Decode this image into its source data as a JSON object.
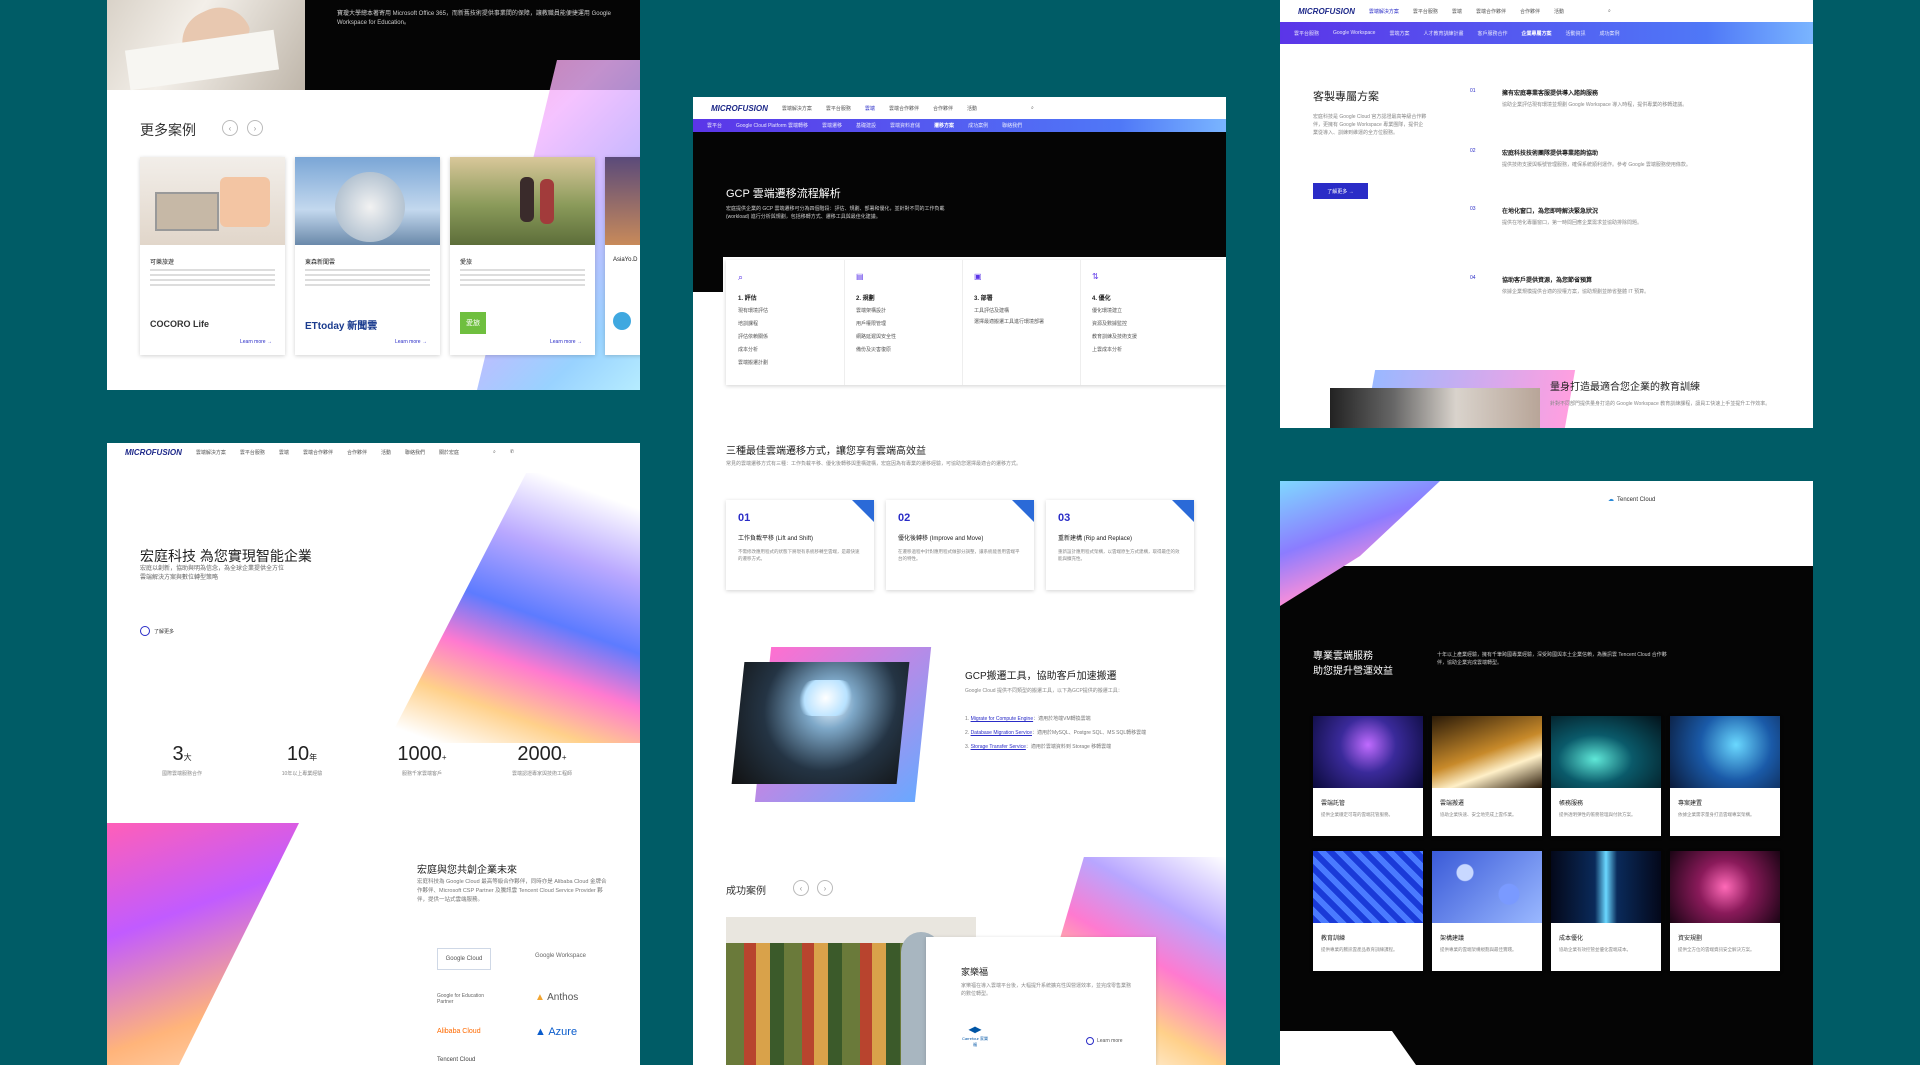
{
  "p1": {
    "top_text": "寶瓊大學總本著寄用 Microsoft Office 365，而新舊技術提供事業間的保障，讓教職員能便捷運用 Google Workspace for Education。",
    "more_cases_title": "更多案例",
    "cases": [
      {
        "title": "可樂旅遊",
        "logo": "COCORO Life",
        "link": "Learn more →"
      },
      {
        "title": "東森新聞雲",
        "logo": "ETtoday 新聞雲",
        "link": "Learn more →"
      },
      {
        "title": "愛旅",
        "logo": "愛旅",
        "link": "Learn more →"
      },
      {
        "title": "AsiaYo.D",
        "logo": "",
        "link": ""
      }
    ]
  },
  "p2": {
    "nav_items": [
      "雲端解決方案",
      "雲平台服務",
      "雲端",
      "雲端合作夥伴",
      "合作夥伴",
      "活動",
      "聯絡我們",
      "關於宏庭"
    ],
    "hero_title": "宏庭科技 為您實現智能企業",
    "hero_sub": "宏庭以創新，協助與明為信念，為全球企業提供全方位雲端解決方案與數位轉型策略",
    "hero_link": "了解更多",
    "stats": [
      {
        "num": "3",
        "unit": "大",
        "label": "國際雲端服務合作"
      },
      {
        "num": "10",
        "unit": "年",
        "label": "10年以上專業經驗"
      },
      {
        "num": "1000",
        "unit": "+",
        "label": "服務千家雲端客戶"
      },
      {
        "num": "2000",
        "unit": "+",
        "label": "雲端認證專家與技術工程師"
      }
    ],
    "future_title": "宏庭與您共創企業未來",
    "future_text": "宏庭科技為 Google Cloud 最高等級合作夥伴，同時亦是 Alibaba Cloud 金牌合作夥伴、Microsoft CSP Partner 及騰訊雲 Tencent Cloud Service Provider 夥伴，提供一站式雲端服務。",
    "partners": [
      "Google Cloud",
      "Google Workspace",
      "Google for Education Partner",
      "Anthos",
      "Alibaba Cloud",
      "Azure",
      "Tencent Cloud"
    ]
  },
  "p3": {
    "brand": "MICROFUSION",
    "subnav": [
      "雲平台",
      "Google Cloud Platform 雲端轉移",
      "雲端遷移",
      "基礎建設",
      "雲端資料倉儲",
      "遷移方案",
      "成功案例",
      "聯絡我們"
    ],
    "hero_title": "GCP 雲端遷移流程解析",
    "hero_text": "宏庭提供企業的 GCP 雲端遷移可分為四個階段：評估、規劃、部署和優化，並針對不同的工作負載 (workload) 進行分析與規劃，包括移轉方式、遷移工具與最佳化建議。",
    "steps": [
      {
        "title": "1. 評估",
        "items": [
          "現有環境評估",
          "培訓課程",
          "評估依賴關係",
          "成本分析",
          "雲端搬遷計劃"
        ]
      },
      {
        "title": "2. 規劃",
        "items": [
          "雲端架構設計",
          "用戶權限管理",
          "網路延遲與安全性",
          "備份及災害復原"
        ]
      },
      {
        "title": "3. 部署",
        "items": [
          "工具評估及建構",
          "選擇最適搬遷工具進行環境部署"
        ]
      },
      {
        "title": "4. 優化",
        "items": [
          "優化環境建立",
          "資源及數據監控",
          "教育訓練及技術支援",
          "上雲成本分析"
        ]
      }
    ],
    "methods_title": "三種最佳雲端遷移方式，讓您享有雲端高效益",
    "methods_sub": "常見的雲端遷移方式有三種：工作負載平移、優化後轉移與重構建構，宏庭因為有專業的遷移經驗，可協助您選擇最適合的遷移方式。",
    "methods": [
      {
        "num": "01",
        "title": "工作負載平移 (Lift and Shift)",
        "text": "不需修改應用程式的狀態下將現有系統移轉至雲端，是最快速的遷移方式。"
      },
      {
        "num": "02",
        "title": "優化後轉移 (Improve and Move)",
        "text": "在遷移過程中針對應用程式做部分調整，讓系統能善用雲端平台的特性。"
      },
      {
        "num": "03",
        "title": "重新建構 (Rip and Replace)",
        "text": "重新設計應用程式架構，以雲端原生方式建構，取得最佳的效能與擴充性。"
      }
    ],
    "tools_title": "GCP搬遷工具，協助客戶加速搬遷",
    "tools_text": "Google Cloud 提供不同類型的搬遷工具，以下為GCP提供的搬遷工具：",
    "tools": [
      {
        "link": "Migrate for Compute Engine",
        "desc": "：適用於地端VM轉換雲端"
      },
      {
        "link": "Database Migration Service",
        "desc": "：適用於MySQL、Postgre SQL、MS SQL轉移雲端"
      },
      {
        "link": "Storage Transfer Service",
        "desc": "：適用於雲端資料到 Storage 移轉雲端"
      }
    ],
    "success_title": "成功案例",
    "case_title": "家樂福",
    "case_text": "家樂福在導入雲端平台後，大幅提升系統擴充性與營運效率，並完成零售業務的數位轉型。",
    "case_logo": "Carrefour 家樂福",
    "case_link": "Learn more"
  },
  "p4": {
    "brand": "MICROFUSION",
    "subnav": [
      "雲平台服務",
      "Google Workspace",
      "雲端方案",
      "人才教育訓練計畫",
      "客戶服務合作",
      "企業專屬方案",
      "活動資訊",
      "成功案例",
      "聯絡我們"
    ],
    "title": "客製專屬方案",
    "intro": "宏庭科技是 Google Cloud 官方認證最高等級合作夥伴，更擁有 Google Workspace 專業團隊，提供企業從導入、訓練到維運的全方位服務。",
    "button": "了解更多 →",
    "items": [
      {
        "num": "01",
        "title": "擁有宏庭專業客服提供導入諮詢服務",
        "text": "協助企業評估現有環境並規劃 Google Workspace 導入時程，提供專業的移轉建議。"
      },
      {
        "num": "02",
        "title": "宏庭科技技術團隊提供專業諮詢協助",
        "text": "提供技術支援與帳號管理服務，確保系統順利運作。參考 Google 雲端服務使用條款。"
      },
      {
        "num": "03",
        "title": "在地化窗口，為您即時解決緊急狀況",
        "text": "提供在地化專屬窗口，第一時間回應企業需求並協助排除問題。"
      },
      {
        "num": "04",
        "title": "協助客戶提供資源，為您節省預算",
        "text": "依據企業規模提供合適的授權方案，協助規劃並節省整體 IT 預算。"
      }
    ],
    "training_title": "量身打造最適合您企業的教育訓練",
    "training_text": "針對不同部門提供量身打造的 Google Workspace 教育訓練課程，讓員工快速上手並提升工作效率。"
  },
  "p5": {
    "partner_logo": "Tencent Cloud",
    "title_line1": "專業雲端服務",
    "title_line2": "助您提升營運效益",
    "intro": "十年以上產業經驗，擁有千筆跨國專業經驗，深受跨國與本土企業信賴，為騰訊雲 Tencent Cloud 合作夥伴，協助企業完成雲端轉型。",
    "services": [
      {
        "title": "雲端託管",
        "text": "提供企業穩定可靠的雲端託管服務。"
      },
      {
        "title": "雲端搬遷",
        "text": "協助企業快速、安全地完成上雲作業。"
      },
      {
        "title": "帳務服務",
        "text": "提供透明彈性的帳務管理與付款方案。"
      },
      {
        "title": "專案建置",
        "text": "依據企業需求量身打造雲端專案架構。"
      },
      {
        "title": "教育訓練",
        "text": "提供專業的騰訊雲產品教育訓練課程。"
      },
      {
        "title": "架構建議",
        "text": "提供專業的雲端架構規劃與最佳實踐。"
      },
      {
        "title": "成本優化",
        "text": "協助企業有效控管並優化雲端成本。"
      },
      {
        "title": "資安規劃",
        "text": "提供全方位的雲端資訊安全解決方案。"
      }
    ]
  },
  "colors": {
    "bg": "#005c66",
    "accent": "#2a2cc7",
    "dark": "#050505"
  }
}
